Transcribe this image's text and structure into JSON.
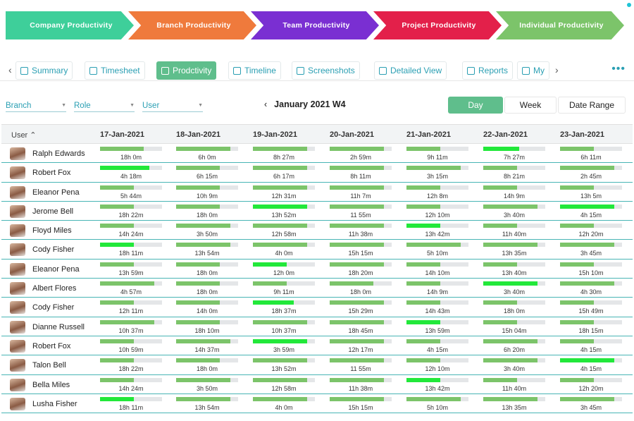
{
  "ribbon": [
    {
      "label": "Company Productivity",
      "color": "#3ecf9a"
    },
    {
      "label": "Branch Productivity",
      "color": "#ef7a3c"
    },
    {
      "label": "Team Productivity",
      "color": "#7a2fd2"
    },
    {
      "label": "Project Productivity",
      "color": "#e3204a"
    },
    {
      "label": "Individual Productivity",
      "color": "#7cc46a"
    }
  ],
  "tabs": [
    {
      "label": "Summary",
      "icon": "summary-icon"
    },
    {
      "label": "Timesheet",
      "icon": "calendar-icon"
    },
    {
      "label": "Prodctivity",
      "icon": "productivity-icon",
      "active": true
    },
    {
      "label": "Timeline",
      "icon": "chart-line-icon"
    },
    {
      "label": "Screenshots",
      "icon": "camera-icon"
    },
    {
      "label": "Detailed View",
      "icon": "clock-icon"
    },
    {
      "label": "Reports",
      "icon": "document-icon"
    },
    {
      "label": "My",
      "icon": "grid-icon"
    }
  ],
  "filters": {
    "branch": "Branch",
    "role": "Role",
    "user": "User"
  },
  "week_label": "January 2021 W4",
  "view_modes": {
    "day": "Day",
    "week": "Week",
    "range": "Date Range"
  },
  "table": {
    "user_header": "User",
    "dates": [
      "17-Jan-2021",
      "18-Jan-2021",
      "19-Jan-2021",
      "20-Jan-2021",
      "21-Jan-2021",
      "22-Jan-2021",
      "23-Jan-2021"
    ],
    "colors": {
      "normal": "#7cc46a",
      "high": "#22e83a",
      "track": "#e4e6e8"
    },
    "rows": [
      {
        "name": "Ralph Edwards",
        "cells": [
          {
            "t": "18h 0m",
            "f": 0.7
          },
          {
            "t": "6h 0m",
            "f": 0.88
          },
          {
            "t": "8h 27m",
            "f": 0.88
          },
          {
            "t": "2h 59m",
            "f": 0.88
          },
          {
            "t": "9h 11m",
            "f": 0.55
          },
          {
            "t": "7h 27m",
            "f": 0.58,
            "h": true
          },
          {
            "t": "6h 11m",
            "f": 0.55
          }
        ]
      },
      {
        "name": "Robert Fox",
        "cells": [
          {
            "t": "4h 18m",
            "f": 0.8,
            "h": true
          },
          {
            "t": "6h 15m",
            "f": 0.7
          },
          {
            "t": "6h 17m",
            "f": 0.88
          },
          {
            "t": "8h 11m",
            "f": 0.88
          },
          {
            "t": "3h 15m",
            "f": 0.88
          },
          {
            "t": "8h 21m",
            "f": 0.55
          },
          {
            "t": "2h 45m",
            "f": 0.88
          }
        ]
      },
      {
        "name": "Eleanor Pena",
        "cells": [
          {
            "t": "5h 44m",
            "f": 0.55
          },
          {
            "t": "10h 9m",
            "f": 0.7
          },
          {
            "t": "12h 31m",
            "f": 0.88
          },
          {
            "t": "11h 7m",
            "f": 0.88
          },
          {
            "t": "12h 8m",
            "f": 0.55
          },
          {
            "t": "14h 9m",
            "f": 0.55
          },
          {
            "t": "13h 5m",
            "f": 0.55
          }
        ]
      },
      {
        "name": "Jerome Bell",
        "cells": [
          {
            "t": "18h 22m",
            "f": 0.55
          },
          {
            "t": "18h 0m",
            "f": 0.7
          },
          {
            "t": "13h 52m",
            "f": 0.88,
            "h": true
          },
          {
            "t": "11 55m",
            "f": 0.88
          },
          {
            "t": "12h 10m",
            "f": 0.55
          },
          {
            "t": "3h 40m",
            "f": 0.88
          },
          {
            "t": "4h 15m",
            "f": 0.88,
            "h": true
          }
        ]
      },
      {
        "name": "Floyd Miles",
        "cells": [
          {
            "t": "14h 24m",
            "f": 0.55
          },
          {
            "t": "3h 50m",
            "f": 0.88
          },
          {
            "t": "12h 58m",
            "f": 0.88
          },
          {
            "t": "11h 38m",
            "f": 0.88
          },
          {
            "t": "13h 42m",
            "f": 0.55,
            "h": true
          },
          {
            "t": "11h 40m",
            "f": 0.55
          },
          {
            "t": "12h 20m",
            "f": 0.55
          }
        ]
      },
      {
        "name": "Cody Fisher",
        "cells": [
          {
            "t": "18h 11m",
            "f": 0.55,
            "h": true
          },
          {
            "t": "13h 54m",
            "f": 0.88
          },
          {
            "t": "4h 0m",
            "f": 0.88
          },
          {
            "t": "15h 15m",
            "f": 0.88
          },
          {
            "t": "5h 10m",
            "f": 0.88
          },
          {
            "t": "13h 35m",
            "f": 0.88
          },
          {
            "t": "3h 45m",
            "f": 0.88
          }
        ]
      },
      {
        "name": "Eleanor Pena",
        "cells": [
          {
            "t": "13h 59m",
            "f": 0.55
          },
          {
            "t": "18h 0m",
            "f": 0.7
          },
          {
            "t": "12h 0m",
            "f": 0.55,
            "h": true
          },
          {
            "t": "18h 20m",
            "f": 0.88
          },
          {
            "t": "14h 10m",
            "f": 0.55
          },
          {
            "t": "13h 40m",
            "f": 0.55
          },
          {
            "t": "15h 10m",
            "f": 0.55
          }
        ]
      },
      {
        "name": "Albert Flores",
        "cells": [
          {
            "t": "4h 57m",
            "f": 0.88
          },
          {
            "t": "18h 0m",
            "f": 0.7
          },
          {
            "t": "9h 11m",
            "f": 0.55
          },
          {
            "t": "18h 0m",
            "f": 0.7
          },
          {
            "t": "14h 9m",
            "f": 0.55
          },
          {
            "t": "3h 40m",
            "f": 0.88,
            "h": true
          },
          {
            "t": "4h 30m",
            "f": 0.88
          }
        ]
      },
      {
        "name": "Cody Fisher",
        "cells": [
          {
            "t": "12h 11m",
            "f": 0.55
          },
          {
            "t": "14h 0m",
            "f": 0.7
          },
          {
            "t": "18h 37m",
            "f": 0.66,
            "h": true
          },
          {
            "t": "15h 29m",
            "f": 0.88
          },
          {
            "t": "14h 43m",
            "f": 0.55
          },
          {
            "t": "18h 0m",
            "f": 0.55
          },
          {
            "t": "15h 49m",
            "f": 0.55
          }
        ]
      },
      {
        "name": "Dianne Russell",
        "cells": [
          {
            "t": "10h 37m",
            "f": 0.88
          },
          {
            "t": "18h 10m",
            "f": 0.7
          },
          {
            "t": "10h 37m",
            "f": 0.88
          },
          {
            "t": "18h 45m",
            "f": 0.88
          },
          {
            "t": "13h 59m",
            "f": 0.55,
            "h": true
          },
          {
            "t": "15h 04m",
            "f": 0.55
          },
          {
            "t": "18h 15m",
            "f": 0.55
          }
        ]
      },
      {
        "name": "Robert Fox",
        "cells": [
          {
            "t": "10h 59m",
            "f": 0.55
          },
          {
            "t": "14h 37m",
            "f": 0.88
          },
          {
            "t": "3h 59m",
            "f": 0.88,
            "h": true
          },
          {
            "t": "12h 17m",
            "f": 0.88
          },
          {
            "t": "4h 15m",
            "f": 0.55
          },
          {
            "t": "6h 20m",
            "f": 0.88
          },
          {
            "t": "4h 15m",
            "f": 0.55
          }
        ]
      },
      {
        "name": "Talon Bell",
        "cells": [
          {
            "t": "18h 22m",
            "f": 0.55
          },
          {
            "t": "18h 0m",
            "f": 0.7
          },
          {
            "t": "13h 52m",
            "f": 0.88
          },
          {
            "t": "11 55m",
            "f": 0.88
          },
          {
            "t": "12h 10m",
            "f": 0.55
          },
          {
            "t": "3h 40m",
            "f": 0.88
          },
          {
            "t": "4h 15m",
            "f": 0.88,
            "h": true
          }
        ]
      },
      {
        "name": "Bella Miles",
        "cells": [
          {
            "t": "14h 24m",
            "f": 0.55
          },
          {
            "t": "3h 50m",
            "f": 0.88
          },
          {
            "t": "12h 58m",
            "f": 0.88
          },
          {
            "t": "11h 38m",
            "f": 0.88
          },
          {
            "t": "13h 42m",
            "f": 0.55,
            "h": true
          },
          {
            "t": "11h 40m",
            "f": 0.55
          },
          {
            "t": "12h 20m",
            "f": 0.55
          }
        ]
      },
      {
        "name": "Lusha Fisher",
        "cells": [
          {
            "t": "18h 11m",
            "f": 0.55,
            "h": true
          },
          {
            "t": "13h 54m",
            "f": 0.88
          },
          {
            "t": "4h 0m",
            "f": 0.88
          },
          {
            "t": "15h 15m",
            "f": 0.88
          },
          {
            "t": "5h 10m",
            "f": 0.88
          },
          {
            "t": "13h 35m",
            "f": 0.88
          },
          {
            "t": "3h 45m",
            "f": 0.88
          }
        ]
      }
    ]
  }
}
